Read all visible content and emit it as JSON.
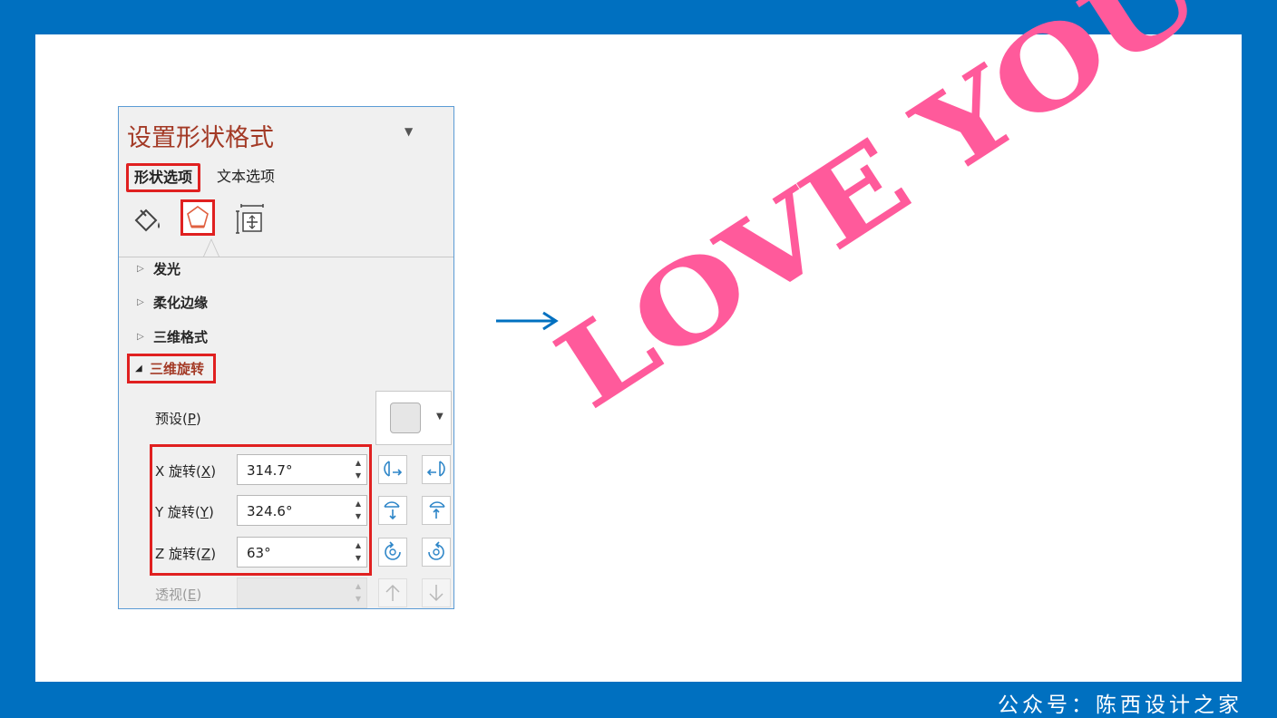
{
  "panel": {
    "title": "设置形状格式",
    "dropdown_glyph": "▼",
    "tabs": [
      {
        "label": "形状选项",
        "active": true
      },
      {
        "label": "文本选项",
        "active": false
      }
    ],
    "categories": [
      "fill-line-icon",
      "effects-pentagon-icon",
      "size-properties-icon"
    ],
    "sections": [
      {
        "label": "发光",
        "expanded": false
      },
      {
        "label": "柔化边缘",
        "expanded": false
      },
      {
        "label": "三维格式",
        "expanded": false
      },
      {
        "label": "三维旋转",
        "expanded": true
      }
    ],
    "collapsed_glyph": "▷",
    "expanded_glyph": "◢",
    "preset": {
      "label": "预设",
      "key": "P"
    },
    "rotations": [
      {
        "label": "X 旋转",
        "key": "X",
        "value": "314.7°"
      },
      {
        "label": "Y 旋转",
        "key": "Y",
        "value": "324.6°"
      },
      {
        "label": "Z 旋转",
        "key": "Z",
        "value": "63°"
      }
    ],
    "perspective": {
      "label": "透视",
      "key": "E",
      "value": ""
    }
  },
  "result_text": "LOVE YOU",
  "footer": "公众号：陈西设计之家",
  "colors": {
    "frame": "#0070c0",
    "highlight": "#e02020",
    "title": "#a33a26",
    "text_art": "#ff5a9b",
    "arrow": "#0070c0",
    "icon_blue": "#2e86c8"
  }
}
